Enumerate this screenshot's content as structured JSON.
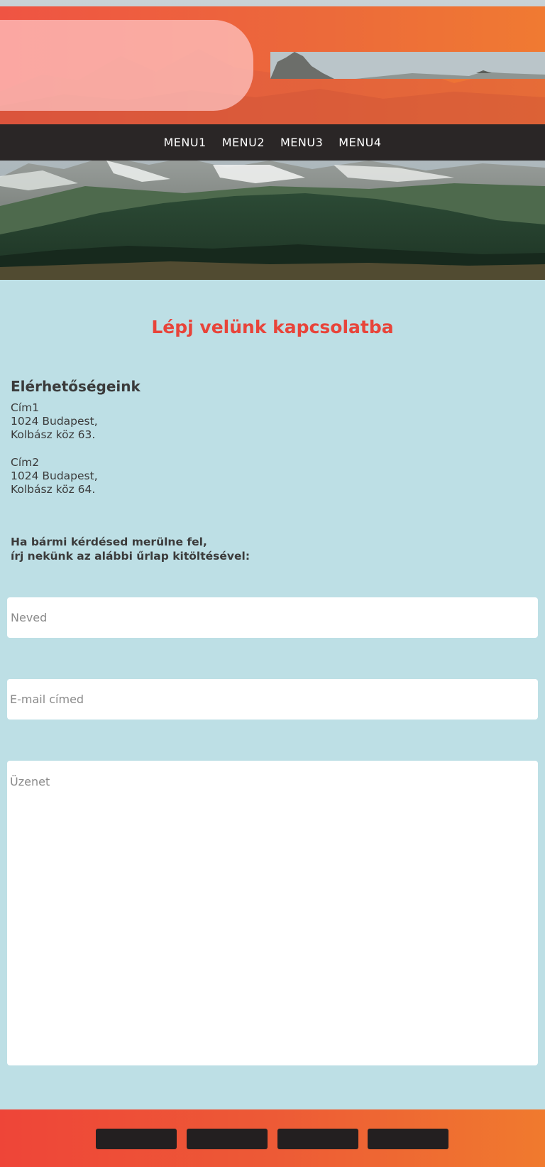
{
  "nav": {
    "items": [
      {
        "label": "MENU1"
      },
      {
        "label": "MENU2"
      },
      {
        "label": "MENU3"
      },
      {
        "label": "MENU4"
      }
    ]
  },
  "main": {
    "title": "Lépj velünk kapcsolatba",
    "contact": {
      "heading": "Elérhetőségeink",
      "addresses": [
        {
          "name": "Cím1",
          "line1": "1024 Budapest,",
          "line2": "Kolbász köz 63."
        },
        {
          "name": "Cím2",
          "line1": "1024 Budapest,",
          "line2": "Kolbász köz 64."
        }
      ]
    },
    "intro": {
      "line1": "Ha bármi kérdésed merülne fel,",
      "line2": "írj nekünk az alábbi űrlap kitöltésével:"
    },
    "form": {
      "name_placeholder": "Neved",
      "email_placeholder": "E-mail címed",
      "message_placeholder": "Üzenet"
    }
  },
  "colors": {
    "accent": "#e8443a",
    "header_gradient_start": "#ef5443",
    "header_gradient_end": "#f07a32",
    "navbar": "#2a2626",
    "background": "#bddfe5",
    "footer_button": "#231f20"
  }
}
